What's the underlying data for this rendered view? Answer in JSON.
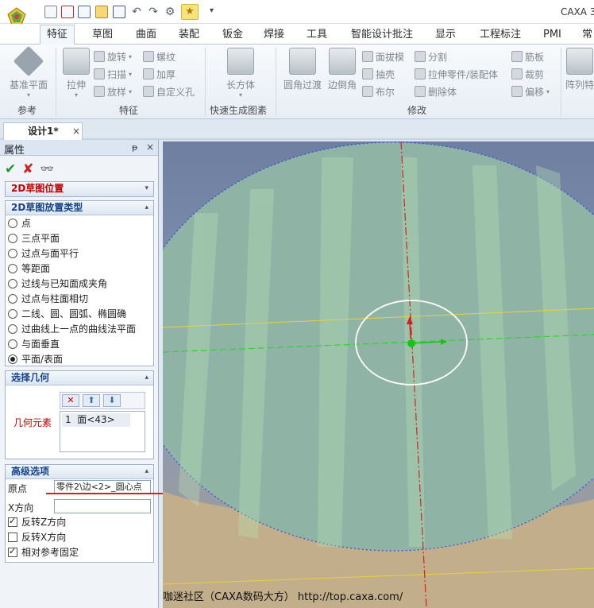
{
  "app": {
    "title": "CAXA 3"
  },
  "ribbon_tabs": [
    "特征",
    "草图",
    "曲面",
    "装配",
    "钣金",
    "焊接",
    "工具",
    "智能设计批注",
    "显示",
    "工程标注",
    "PMI",
    "常"
  ],
  "ribbon": {
    "ref_btn": "基准平面",
    "ref_group": "参考",
    "extrude": "拉伸",
    "rotate": "旋转",
    "sweep": "扫描",
    "loft": "放样",
    "thread": "螺纹",
    "thicken": "加厚",
    "custom_hole": "自定义孔",
    "feature_group": "特征",
    "box": "长方体",
    "quick_group": "快速生成图素",
    "fillet": "圆角过渡",
    "chamfer": "边倒角",
    "draft": "面拔模",
    "shell": "抽壳",
    "boolean": "布尔",
    "split": "分割",
    "stretch": "拉伸零件/装配体",
    "delete_body": "删除体",
    "rib": "筋板",
    "trim": "裁剪",
    "offset": "偏移",
    "modify_group": "修改",
    "array": "阵列特"
  },
  "document": {
    "tab": "设计1*",
    "close": "×"
  },
  "panel": {
    "title": "属性",
    "pin": "ᵽ",
    "close": "×",
    "ok": "✔",
    "cancel": "✘",
    "preview": "👓",
    "sec_position": "2D草图位置",
    "sec_type": "2D草图放置类型",
    "radio_options": [
      "点",
      "三点平面",
      "过点与面平行",
      "等距面",
      "过线与已知面成夹角",
      "过点与柱面相切",
      "二线、圆、圆弧、椭圆确",
      "过曲线上一点的曲线法平面",
      "与面垂直",
      "平面/表面"
    ],
    "selected_radio": "平面/表面",
    "sec_geometry": "选择几何",
    "geo_label": "几何元素",
    "geo_item_index": "1",
    "geo_item_name": "面<43>",
    "sec_advanced": "高级选项",
    "origin_label": "原点",
    "origin_value": "零件2\\边<2>_圆心点",
    "xdir_label": "X方向",
    "xdir_value": "",
    "checks": [
      {
        "label": "反转Z方向",
        "checked": true
      },
      {
        "label": "反转X方向",
        "checked": false
      },
      {
        "label": "相对参考固定",
        "checked": true
      }
    ]
  },
  "watermark": "咖迷社区（CAXA数码大方） http://top.caxa.com/",
  "colors": {
    "accent_blue": "#15428b",
    "section_red": "#c00000",
    "viewport_face": "#8fb4a6",
    "sketch_green": "#2bd52b",
    "axis_red": "#d42020",
    "axis_yellow": "#e8d23a"
  }
}
